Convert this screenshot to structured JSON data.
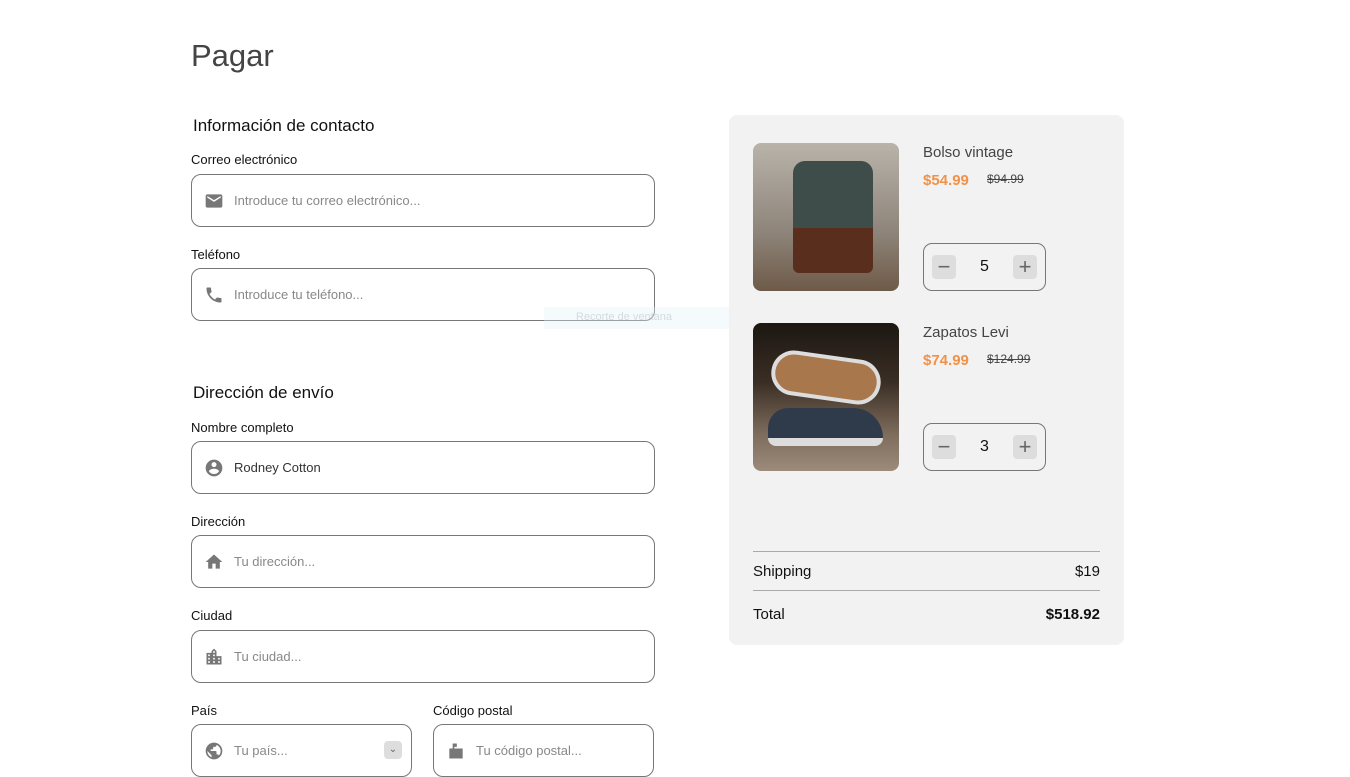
{
  "page_title": "Pagar",
  "contact": {
    "heading": "Información de contacto",
    "email_label": "Correo electrónico",
    "email_placeholder": "Introduce tu correo electrónico...",
    "phone_label": "Teléfono",
    "phone_placeholder": "Introduce tu teléfono..."
  },
  "shipping": {
    "heading": "Dirección de envío",
    "name_label": "Nombre completo",
    "name_value": "Rodney Cotton",
    "address_label": "Dirección",
    "address_placeholder": "Tu dirección...",
    "city_label": "Ciudad",
    "city_placeholder": "Tu ciudad...",
    "country_label": "País",
    "country_placeholder": "Tu país...",
    "zip_label": "Código postal",
    "zip_placeholder": "Tu código postal..."
  },
  "overlay_text": "Recorte de ventana",
  "cart": {
    "items": [
      {
        "name": "Bolso vintage",
        "price": "$54.99",
        "old_price": "$94.99",
        "qty": "5"
      },
      {
        "name": "Zapatos Levi",
        "price": "$74.99",
        "old_price": "$124.99",
        "qty": "3"
      }
    ],
    "shipping_label": "Shipping",
    "shipping_value": "$19",
    "total_label": "Total",
    "total_value": "$518.92"
  },
  "colors": {
    "accent": "#f0924a",
    "panel": "#f2f2f2"
  }
}
